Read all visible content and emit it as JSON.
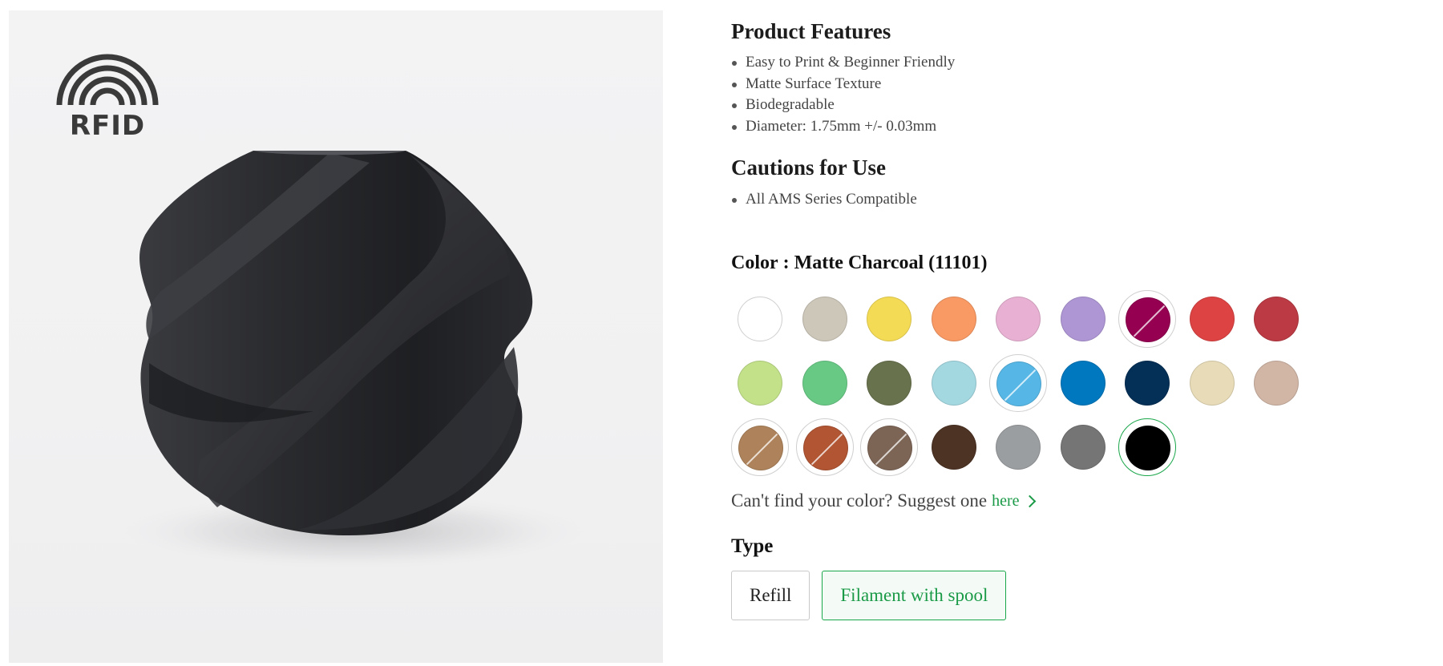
{
  "product_image": {
    "badge_text": "RFID"
  },
  "features": {
    "title": "Product Features",
    "items": [
      "Easy to Print & Beginner Friendly",
      "Matte Surface Texture",
      "Biodegradable",
      "Diameter: 1.75mm +/- 0.03mm"
    ]
  },
  "cautions": {
    "title": "Cautions for Use",
    "items": [
      "All AMS Series Compatible"
    ]
  },
  "color": {
    "label": "Color",
    "selected_name": "Matte Charcoal (11101)",
    "swatches": [
      {
        "hex": "#ffffff",
        "state": "available"
      },
      {
        "hex": "#cdc7b9",
        "state": "available"
      },
      {
        "hex": "#f4db55",
        "state": "available"
      },
      {
        "hex": "#f99963",
        "state": "available"
      },
      {
        "hex": "#e8b0d2",
        "state": "available"
      },
      {
        "hex": "#ae96d5",
        "state": "available"
      },
      {
        "hex": "#950051",
        "state": "soldout"
      },
      {
        "hex": "#de4343",
        "state": "available"
      },
      {
        "hex": "#bb3a43",
        "state": "available"
      },
      {
        "hex": "#c2e189",
        "state": "available"
      },
      {
        "hex": "#68c985",
        "state": "available"
      },
      {
        "hex": "#68724d",
        "state": "available"
      },
      {
        "hex": "#a3d8e1",
        "state": "available"
      },
      {
        "hex": "#56b7e6",
        "state": "soldout"
      },
      {
        "hex": "#0078bf",
        "state": "available"
      },
      {
        "hex": "#042f56",
        "state": "available"
      },
      {
        "hex": "#e8dbb7",
        "state": "available"
      },
      {
        "hex": "#d1b5a5",
        "state": "available"
      },
      {
        "hex": "#ae835b",
        "state": "soldout"
      },
      {
        "hex": "#b15533",
        "state": "soldout"
      },
      {
        "hex": "#7d6556",
        "state": "soldout"
      },
      {
        "hex": "#4d3324",
        "state": "available"
      },
      {
        "hex": "#9b9ea0",
        "state": "available"
      },
      {
        "hex": "#757575",
        "state": "available"
      },
      {
        "hex": "#000000",
        "state": "selected"
      }
    ]
  },
  "suggest": {
    "text": "Can't find your color? Suggest one",
    "link_label": "here"
  },
  "type": {
    "title": "Type",
    "options": [
      {
        "label": "Refill",
        "selected": false
      },
      {
        "label": "Filament with spool",
        "selected": true
      }
    ]
  },
  "accent_color": "#1aa64a"
}
